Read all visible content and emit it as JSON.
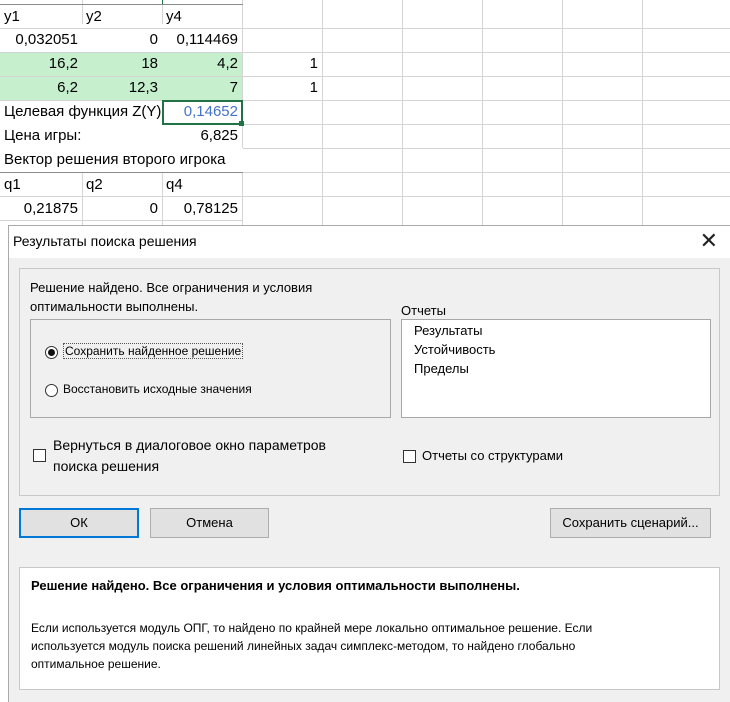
{
  "sheet": {
    "headers1": [
      "y1",
      "y2",
      "y4"
    ],
    "row1": [
      "0,032051",
      "0",
      "0,114469"
    ],
    "row2": [
      "16,2",
      "18",
      "4,2",
      "1"
    ],
    "row3": [
      "6,2",
      "12,3",
      "7",
      "1"
    ],
    "target_label": "Целевая функция Z(Y)",
    "target_value": "0,14652",
    "price_label": "Цена игры:",
    "price_value": "6,825",
    "vector_label": "Вектор решения второго игрока",
    "headers2": [
      "q1",
      "q2",
      "q4"
    ],
    "row4": [
      "0,21875",
      "0",
      "0,78125"
    ]
  },
  "dialog": {
    "title": "Результаты поиска решения",
    "message_line1": "Решение найдено. Все ограничения и условия",
    "message_line2": "оптимальности выполнены.",
    "radio_keep": "Сохранить найденное решение",
    "radio_restore": "Восстановить исходные значения",
    "reports_label": "Отчеты",
    "reports": [
      "Результаты",
      "Устойчивость",
      "Пределы"
    ],
    "return_line1": "Вернуться в диалоговое окно параметров",
    "return_line2": "поиска решения",
    "outline_reports": "Отчеты со структурами",
    "ok": "ОК",
    "cancel": "Отмена",
    "save_scenario": "Сохранить сценарий...",
    "info_title": "Решение найдено. Все ограничения и условия оптимальности выполнены.",
    "info_line1": "Если используется модуль ОПГ, то найдено по крайней мере локально оптимальное решение. Если",
    "info_line2": "используется модуль поиска решений линейных задач симплекс-методом, то найдено глобально",
    "info_line3": "оптимальное решение."
  }
}
